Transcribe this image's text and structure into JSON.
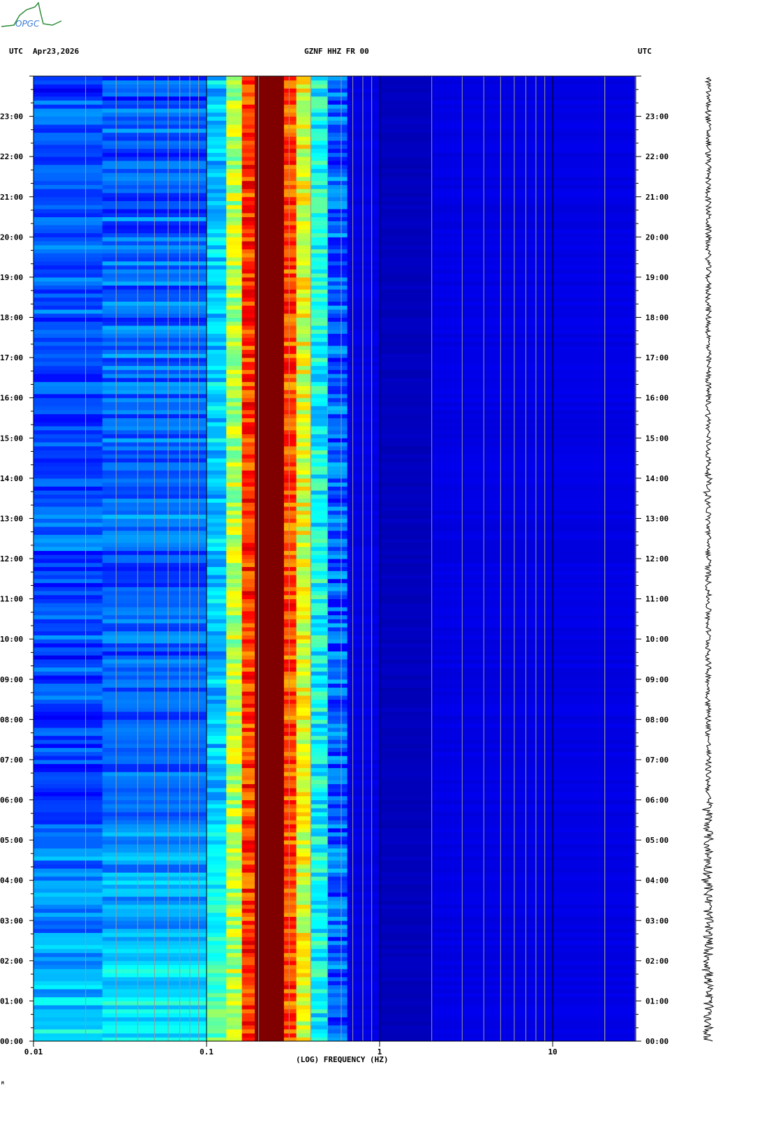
{
  "header": {
    "logo_text": "OPGC",
    "left_label": "UTC",
    "date": "Apr23,2026",
    "station": "GZNF HHZ FR 00",
    "right_label": "UTC"
  },
  "footer_mark": "M",
  "chart_data": {
    "type": "heatmap",
    "title": "GZNF HHZ FR 00",
    "xlabel": "(LOG) FREQUENCY (HZ)",
    "x_scale": "log",
    "xlim": [
      0.01,
      30
    ],
    "x_ticks": [
      {
        "value": 0.01,
        "label": "0.01"
      },
      {
        "value": 0.1,
        "label": "0.1"
      },
      {
        "value": 1,
        "label": "1"
      },
      {
        "value": 10,
        "label": "10"
      }
    ],
    "ylabel": "UTC",
    "ylim_hours": [
      0,
      24
    ],
    "y_ticks": [
      "00:00",
      "01:00",
      "02:00",
      "03:00",
      "04:00",
      "05:00",
      "06:00",
      "07:00",
      "08:00",
      "09:00",
      "10:00",
      "11:00",
      "12:00",
      "13:00",
      "14:00",
      "15:00",
      "16:00",
      "17:00",
      "18:00",
      "19:00",
      "20:00",
      "21:00",
      "22:00",
      "23:00"
    ],
    "colormap": "jet",
    "spectral_profile": [
      {
        "f_min": 0.01,
        "f_max": 0.025,
        "level": 0.2
      },
      {
        "f_min": 0.025,
        "f_max": 0.1,
        "level": 0.22
      },
      {
        "f_min": 0.1,
        "f_max": 0.13,
        "level": 0.32
      },
      {
        "f_min": 0.13,
        "f_max": 0.16,
        "level": 0.55
      },
      {
        "f_min": 0.16,
        "f_max": 0.19,
        "level": 0.82
      },
      {
        "f_min": 0.19,
        "f_max": 0.28,
        "level": 1.0
      },
      {
        "f_min": 0.28,
        "f_max": 0.33,
        "level": 0.8
      },
      {
        "f_min": 0.33,
        "f_max": 0.4,
        "level": 0.6
      },
      {
        "f_min": 0.4,
        "f_max": 0.5,
        "level": 0.38
      },
      {
        "f_min": 0.5,
        "f_max": 0.65,
        "level": 0.22
      },
      {
        "f_min": 0.65,
        "f_max": 1.0,
        "level": 0.1
      },
      {
        "f_min": 1.0,
        "f_max": 2.0,
        "level": 0.06
      },
      {
        "f_min": 2.0,
        "f_max": 30,
        "level": 0.1
      }
    ],
    "low_freq_trend": "higher energy at 0.01-0.1 Hz from 00:00 to 06:00",
    "events": [
      {
        "time_hours": 2.65,
        "f_min": 0.05,
        "f_max": 0.1,
        "level": 0.85
      },
      {
        "time_hours": 2.65,
        "f_min": 0.025,
        "f_max": 0.05,
        "level": 0.6
      },
      {
        "time_hours": 23.95,
        "f_min": 0.025,
        "f_max": 0.07,
        "level": 0.55
      }
    ]
  }
}
